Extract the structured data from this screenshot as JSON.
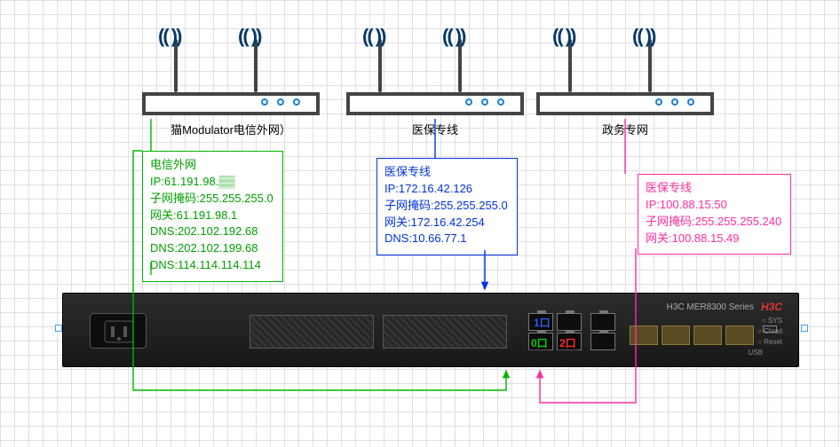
{
  "modems": [
    {
      "label": "猫Modulator电信外网）"
    },
    {
      "label": "医保专线"
    },
    {
      "label": "政务专网"
    }
  ],
  "networks": {
    "telecom": {
      "title": "电信外网",
      "ip": "IP:61.191.98.▒▒",
      "mask": "子网掩码:255.255.255.0",
      "gateway": "网关:61.191.98.1",
      "dns1": "DNS:202.102.192.68",
      "dns2": "DNS:202.102.199.68",
      "dns3": "DNS:114.114.114.114"
    },
    "yibao": {
      "title": "医保专线",
      "ip": "IP:172.16.42.126",
      "mask": "子网掩码:255.255.255.0",
      "gateway": "网关:172.16.42.254",
      "dns1": "DNS:10.66.77.1"
    },
    "gov": {
      "title": "医保专线",
      "ip": "IP:100.88.15.50",
      "mask": "子网掩码:255.255.255.240",
      "gateway": "网关:100.88.15.49"
    }
  },
  "ports": {
    "p1": "1口",
    "p0": "0口",
    "p2": "2口"
  },
  "device": {
    "series": "H3C  MER8300  Series",
    "logo": "H3C",
    "sys": "○ SYS",
    "cloud": "○ Cloud",
    "reset": "○ Reset",
    "usb": "USB"
  },
  "waves": "((   ))"
}
